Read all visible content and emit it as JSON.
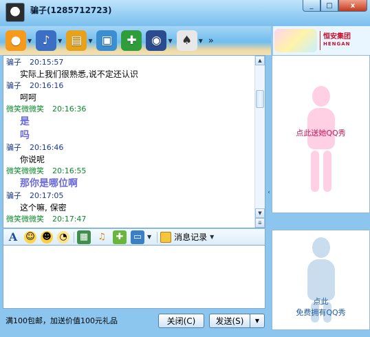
{
  "window": {
    "title": "骗子(1285712723)",
    "controls": [
      "_",
      "□",
      "x"
    ]
  },
  "toolbar": {
    "items": [
      {
        "icon": "video-icon",
        "glyph": "●",
        "color": "#f59a1b"
      },
      {
        "icon": "microphone-icon",
        "glyph": "🎤",
        "color": "#3b6fc4"
      },
      {
        "icon": "send-file-icon",
        "glyph": "📂",
        "color": "#e6a21c"
      },
      {
        "icon": "screenshot-icon",
        "glyph": "▣",
        "color": "#3d8ed0"
      },
      {
        "icon": "add-app-icon",
        "glyph": "✚",
        "color": "#2f9d3b"
      },
      {
        "icon": "police-icon",
        "glyph": "◉",
        "color": "#2a4c8f"
      },
      {
        "icon": "game-icon",
        "glyph": "♠",
        "color": "#555"
      }
    ],
    "more": "»"
  },
  "brand": {
    "line1": "恒安集团",
    "line2": "HENGAN"
  },
  "messages": [
    {
      "sender": "骗子",
      "type": "other",
      "time": "20:15:57",
      "lines": [
        "实际上我们很熟悉,说不定还认识"
      ],
      "big": false
    },
    {
      "sender": "骗子",
      "type": "other",
      "time": "20:16:16",
      "lines": [
        "呵呵"
      ],
      "big": false
    },
    {
      "sender": "微笑微微笑",
      "type": "self",
      "time": "20:16:36",
      "lines": [
        "是",
        "吗"
      ],
      "big": true
    },
    {
      "sender": "骗子",
      "type": "other",
      "time": "20:16:46",
      "lines": [
        "你说呢"
      ],
      "big": false
    },
    {
      "sender": "微笑微微笑",
      "type": "self",
      "time": "20:16:55",
      "lines": [
        "那你是哪位啊"
      ],
      "big": true
    },
    {
      "sender": "骗子",
      "type": "other",
      "time": "20:17:05",
      "lines": [
        "这个嘛, 保密"
      ],
      "big": false
    },
    {
      "sender": "微笑微微笑",
      "type": "self",
      "time": "20:17:47",
      "lines": [],
      "big": false
    }
  ],
  "format_bar": {
    "icons": [
      "font-icon",
      "emoji-icon",
      "wink-icon",
      "clock-icon",
      "image-icon",
      "music-icon",
      "gift-icon",
      "screen-icon"
    ],
    "history_label": "消息记录"
  },
  "input": {
    "value": ""
  },
  "bottom": {
    "promo": "满100包邮，加送价值100元礼品",
    "close_label": "关闭(C)",
    "send_label": "发送(S)",
    "send_arrow": "▼"
  },
  "show_panel": {
    "top_caption": "点此送她QQ秀",
    "bottom_caption_line1": "点此",
    "bottom_caption_line2": "免费拥有QQ秀"
  }
}
